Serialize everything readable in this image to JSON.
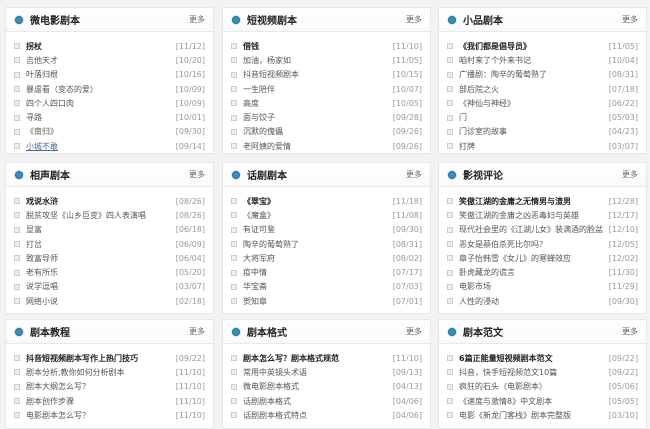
{
  "more_label": "更多",
  "panels": [
    {
      "title": "微电影剧本",
      "items": [
        [
          "拐杖",
          "[11/12]"
        ],
        [
          "吉他天才",
          "[10/20]"
        ],
        [
          "叶落归根",
          "[10/16]"
        ],
        [
          "暴虐看（变态的爱）",
          "[10/09]"
        ],
        [
          "四个人四口肉",
          "[10/09]"
        ],
        [
          "寻路",
          "[10/01]"
        ],
        [
          "《南归》",
          "[09/30]"
        ],
        [
          "小城不敢",
          "[09/14]"
        ]
      ]
    },
    {
      "title": "短视频剧本",
      "items": [
        [
          "借钱",
          "[11/10]"
        ],
        [
          "加油，杨家如",
          "[11/05]"
        ],
        [
          "抖音短视频剧本",
          "[10/15]"
        ],
        [
          "一生陪伴",
          "[10/07]"
        ],
        [
          "高度",
          "[10/05]"
        ],
        [
          "面与饺子",
          "[09/28]"
        ],
        [
          "沉默的傀儡",
          "[09/26]"
        ],
        [
          "老阿姨的爱情",
          "[09/26]"
        ]
      ]
    },
    {
      "title": "小品剧本",
      "items": [
        [
          "《我们都是倡导员》",
          "[11/05]"
        ],
        [
          "咱村来了个外来书记",
          "[10/04]"
        ],
        [
          "广播剧：陶辛的葡萄熟了",
          "[08/31]"
        ],
        [
          "部后院之火",
          "[07/18]"
        ],
        [
          "《神仙与神经》",
          "[06/22]"
        ],
        [
          "门",
          "[05/03]"
        ],
        [
          "门诊室的故事",
          "[04/23]"
        ],
        [
          "打牌",
          "[03/07]"
        ]
      ]
    },
    {
      "title": "相声剧本",
      "items": [
        [
          "戏说水浒",
          "[08/26]"
        ],
        [
          "脱贫攻坚《山乡巨变》四人表演唱",
          "[08/26]"
        ],
        [
          "显富",
          "[06/18]"
        ],
        [
          "打岔",
          "[06/09]"
        ],
        [
          "致富导师",
          "[06/04]"
        ],
        [
          "老有所乐",
          "[05/20]"
        ],
        [
          "说学逗唱",
          "[03/07]"
        ],
        [
          "网络小说",
          "[02/18]"
        ]
      ]
    },
    {
      "title": "话剧剧本",
      "items": [
        [
          "《翠宝》",
          "[11/18]"
        ],
        [
          "《魔盒》",
          "[11/08]"
        ],
        [
          "有证可鉴",
          "[09/30]"
        ],
        [
          "陶辛的葡萄熟了",
          "[08/31]"
        ],
        [
          "大将军府",
          "[08/02]"
        ],
        [
          "疫中情",
          "[07/17]"
        ],
        [
          "华宝斋",
          "[07/03]"
        ],
        [
          "贺知章",
          "[07/01]"
        ]
      ]
    },
    {
      "title": "影视评论",
      "items": [
        [
          "笑傲江湖的金庸之无情男与渣男",
          "[12/28]"
        ],
        [
          "笑傲江湖的金庸之凶恶毒妇与英雄",
          "[12/17]"
        ],
        [
          "现代社会里的《江湖儿女》装满酒的脸盆",
          "[12/10]"
        ],
        [
          "恶女是蔡伯杀死比尔吗？",
          "[12/05]"
        ],
        [
          "章子怡韩雪《女儿》的寒蝉效应",
          "[12/02]"
        ],
        [
          "卧虎藏龙的谎言",
          "[11/30]"
        ],
        [
          "电影市场",
          "[11/29]"
        ],
        [
          "人性的浸动",
          "[09/30]"
        ]
      ]
    },
    {
      "title": "剧本教程",
      "items": [
        [
          "抖音短视频剧本写作上热门技巧",
          "[09/22]"
        ],
        [
          "剧本分析,教你如何分析剧本",
          "[11/10]"
        ],
        [
          "剧本大纲怎么写？",
          "[11/10]"
        ],
        [
          "剧本创作步骤",
          "[11/10]"
        ],
        [
          "电影剧本怎么写？",
          "[11/10]"
        ]
      ]
    },
    {
      "title": "剧本格式",
      "items": [
        [
          "剧本怎么写？剧本格式规范",
          "[11/10]"
        ],
        [
          "常用中英镜头术语",
          "[09/13]"
        ],
        [
          "微电影剧本格式",
          "[04/13]"
        ],
        [
          "话剧剧本格式",
          "[04/06]"
        ],
        [
          "话剧剧本格式特点",
          "[04/06]"
        ]
      ]
    },
    {
      "title": "剧本范文",
      "items": [
        [
          "6篇正能量短视频剧本范文",
          "[09/22]"
        ],
        [
          "抖音，快手短视频范文10篇",
          "[09/22]"
        ],
        [
          "疯狂的石头（电影剧本）",
          "[05/06]"
        ],
        [
          "《速度与激情8》中文剧本",
          "[05/05]"
        ],
        [
          "电影《新龙门客栈》剧本完整版",
          "[03/10]"
        ]
      ]
    }
  ]
}
